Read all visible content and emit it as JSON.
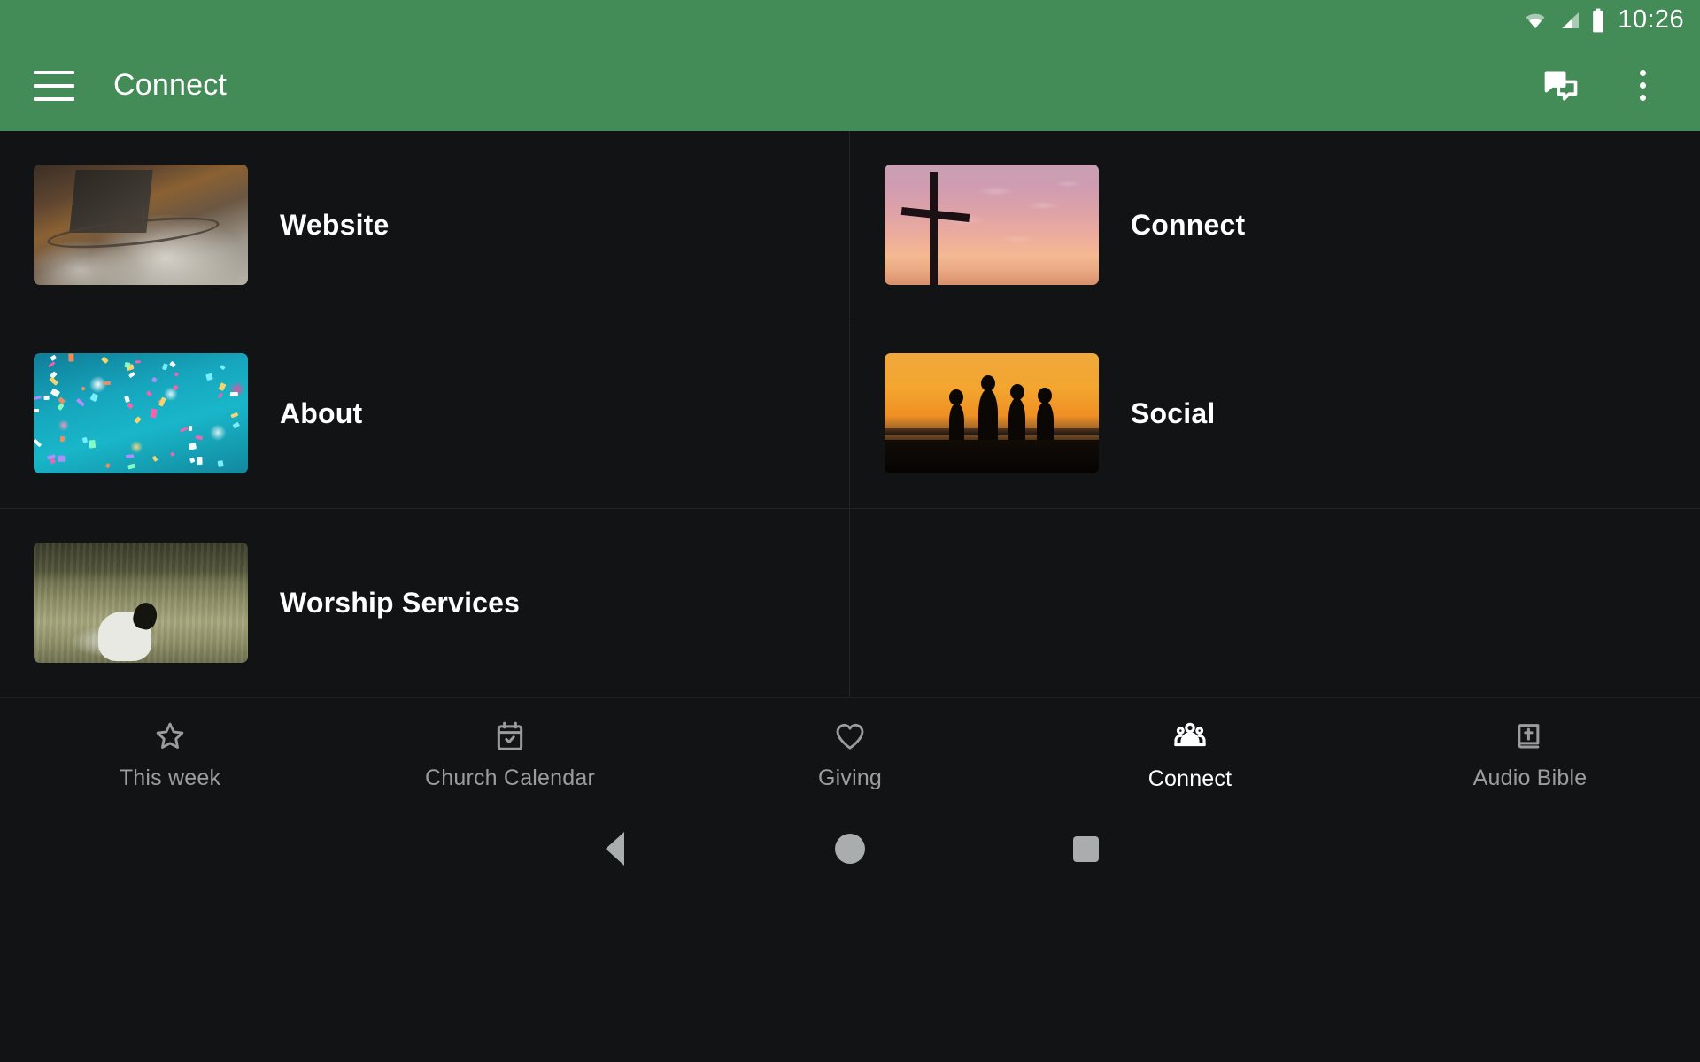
{
  "statusbar": {
    "time": "10:26",
    "icons": [
      "wifi-icon",
      "cellular-signal-icon",
      "battery-icon"
    ]
  },
  "appbar": {
    "menu_icon": "hamburger-menu-icon",
    "title": "Connect",
    "chat_icon": "chat-bubbles-icon",
    "overflow_icon": "overflow-menu-icon",
    "background_color": "#438B57"
  },
  "grid": {
    "items": [
      {
        "label": "Website",
        "thumb": "living-room-coffee-table-photo"
      },
      {
        "label": "Connect",
        "thumb": "cross-at-sunset-photo"
      },
      {
        "label": "About",
        "thumb": "teal-confetti-bokeh-photo"
      },
      {
        "label": "Social",
        "thumb": "four-people-silhouette-sunset-photo"
      },
      {
        "label": "Worship Services",
        "thumb": "sheep-in-grass-field-photo"
      }
    ]
  },
  "bottomnav": {
    "active_index": 3,
    "tabs": [
      {
        "label": "This week",
        "icon": "star-outline-icon"
      },
      {
        "label": "Church Calendar",
        "icon": "calendar-check-icon"
      },
      {
        "label": "Giving",
        "icon": "heart-outline-icon"
      },
      {
        "label": "Connect",
        "icon": "people-group-icon"
      },
      {
        "label": "Audio Bible",
        "icon": "bible-book-icon"
      }
    ],
    "inactive_color": "#9b9c9e",
    "active_color": "#ffffff"
  },
  "sysnav": {
    "back": "back-triangle-icon",
    "home": "home-circle-icon",
    "recents": "recents-square-icon"
  },
  "theme": {
    "background": "#121315",
    "divider": "#242528",
    "accent": "#438B57"
  }
}
